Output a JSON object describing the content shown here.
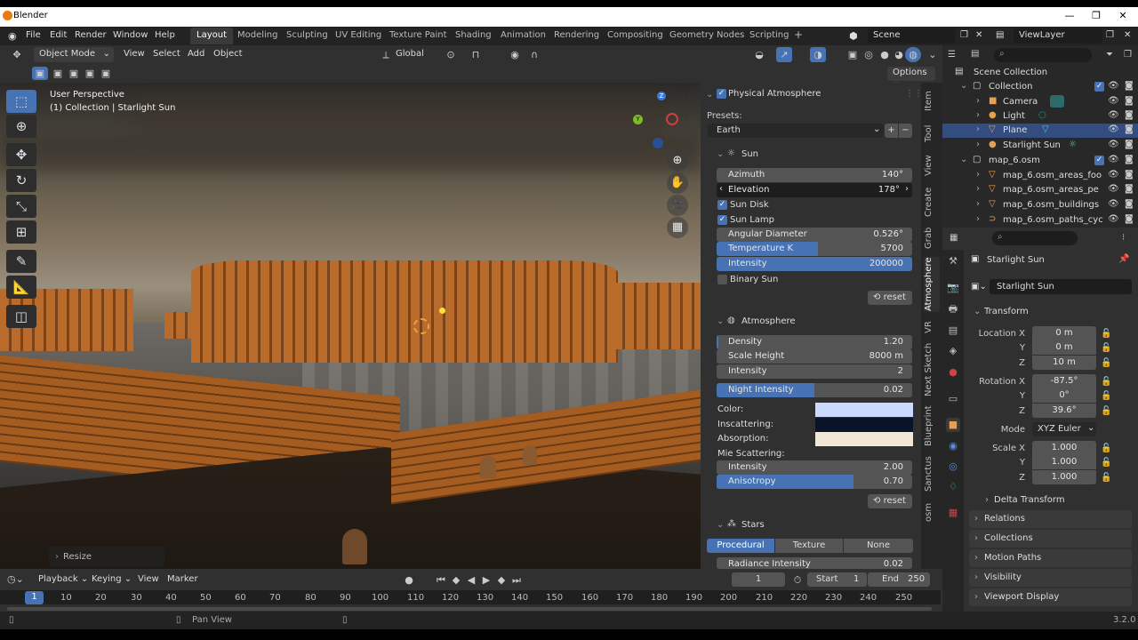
{
  "window": {
    "title": "Blender",
    "controls": [
      "—",
      "❐",
      "✕"
    ]
  },
  "menubar": {
    "items": [
      "File",
      "Edit",
      "Render",
      "Window",
      "Help"
    ]
  },
  "workspaces": [
    "Layout",
    "Modeling",
    "Sculpting",
    "UV Editing",
    "Texture Paint",
    "Shading",
    "Animation",
    "Rendering",
    "Compositing",
    "Geometry Nodes",
    "Scripting"
  ],
  "active_workspace": "Layout",
  "add_workspace": "+",
  "scene": {
    "value": "Scene"
  },
  "view_layer": {
    "value": "ViewLayer"
  },
  "viewport_header": {
    "mode": "Object Mode",
    "menus": [
      "View",
      "Select",
      "Add",
      "Object"
    ],
    "transform_orientation": "Global",
    "options_label": "Options"
  },
  "viewport": {
    "perspective_label": "User Perspective",
    "collection_label": "(1) Collection | Starlight Sun",
    "resize_label": "Resize",
    "gizmo": {
      "z": "Z",
      "y": "Y"
    }
  },
  "npanel": {
    "tabs": [
      "Item",
      "Tool",
      "View",
      "Create",
      "Grab",
      "Atmosphere",
      "VR",
      "Next Sketch",
      "Blueprint",
      "Sanctus",
      "osm"
    ],
    "active_tab": "Atmosphere",
    "header": "Physical Atmosphere",
    "presets_label": "Presets:",
    "preset_value": "Earth",
    "sun": {
      "title": "Sun",
      "azimuth": {
        "label": "Azimuth",
        "value": "140°"
      },
      "elevation": {
        "label": "Elevation",
        "value": "178°"
      },
      "sun_disk": "Sun Disk",
      "sun_lamp": "Sun Lamp",
      "angular_diameter": {
        "label": "Angular Diameter",
        "value": "0.526°"
      },
      "temperature": {
        "label": "Temperature K",
        "value": "5700",
        "fill": 0.52
      },
      "intensity": {
        "label": "Intensity",
        "value": "200000",
        "fill": 1.0
      },
      "binary_sun": "Binary Sun",
      "reset": "reset"
    },
    "atmosphere": {
      "title": "Atmosphere",
      "density": {
        "label": "Density",
        "value": "1.20"
      },
      "scale_height": {
        "label": "Scale Height",
        "value": "8000 m"
      },
      "intensity": {
        "label": "Intensity",
        "value": "2"
      },
      "night_intensity": {
        "label": "Night Intensity",
        "value": "0.02",
        "fill": 0.5
      },
      "color_label": "Color:",
      "inscattering_label": "Inscattering:",
      "absorption_label": "Absorption:",
      "mie_label": "Mie Scattering:",
      "mie_intensity": {
        "label": "Intensity",
        "value": "2.00"
      },
      "anisotropy": {
        "label": "Anisotropy",
        "value": "0.70",
        "fill": 0.7
      },
      "reset": "reset",
      "colors": {
        "color": "#ccd9ff",
        "inscattering": "#0a1428",
        "absorption": "#f2e6d6"
      }
    },
    "stars": {
      "title": "Stars",
      "modes": [
        "Procedural",
        "Texture",
        "None"
      ],
      "active_mode": "Procedural",
      "radiance": {
        "label": "Radiance Intensity",
        "value": "0.02"
      }
    }
  },
  "outliner": {
    "root": "Scene Collection",
    "rows": [
      {
        "label": "Collection"
      },
      {
        "label": "Camera"
      },
      {
        "label": "Light"
      },
      {
        "label": "Plane"
      },
      {
        "label": "Starlight Sun"
      },
      {
        "label": "map_6.osm"
      },
      {
        "label": "map_6.osm_areas_foo"
      },
      {
        "label": "map_6.osm_areas_pe"
      },
      {
        "label": "map_6.osm_buildings"
      },
      {
        "label": "map_6.osm_paths_cyc"
      }
    ]
  },
  "properties": {
    "object_name": "Starlight Sun",
    "data_name": "Starlight Sun",
    "transform_title": "Transform",
    "location": {
      "label": "Location X",
      "x": "0 m",
      "y": "0 m",
      "z": "10 m"
    },
    "rotation": {
      "label": "Rotation X",
      "x": "-87.5°",
      "y": "0°",
      "z": "39.6°"
    },
    "mode": {
      "label": "Mode",
      "value": "XYZ Euler"
    },
    "scale": {
      "label": "Scale X",
      "x": "1.000",
      "y": "1.000",
      "z": "1.000"
    },
    "axis_y": "Y",
    "axis_z": "Z",
    "delta_transform": "Delta Transform",
    "sections": [
      "Relations",
      "Collections",
      "Motion Paths",
      "Visibility",
      "Viewport Display"
    ]
  },
  "timeline": {
    "menus": [
      "Playback",
      "Keying",
      "View",
      "Marker"
    ],
    "current_frame": "1",
    "start_label": "Start",
    "start": "1",
    "end_label": "End",
    "end": "250",
    "ticks": [
      "1",
      "10",
      "20",
      "30",
      "40",
      "50",
      "60",
      "70",
      "80",
      "90",
      "100",
      "110",
      "120",
      "130",
      "140",
      "150",
      "160",
      "170",
      "180",
      "190",
      "200",
      "210",
      "220",
      "230",
      "240",
      "250"
    ]
  },
  "statusbar": {
    "hint": "Pan View",
    "version": "3.2.0"
  }
}
